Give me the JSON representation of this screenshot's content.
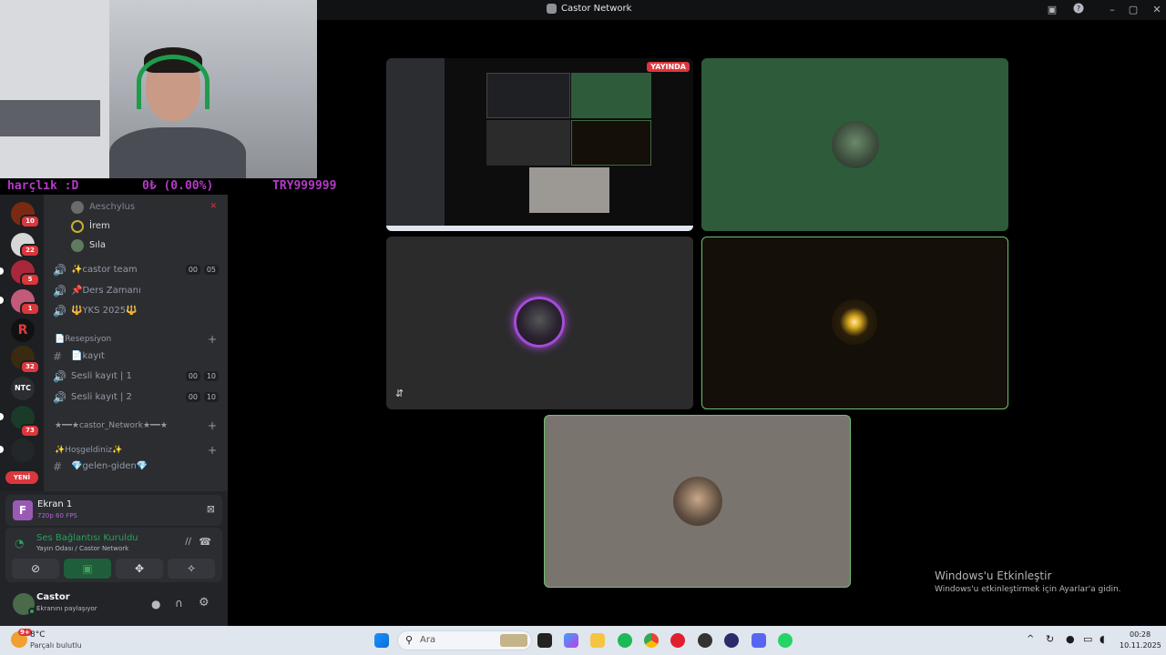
{
  "window": {
    "title": "Castor Network"
  },
  "ticker": {
    "left": "harçlık :D",
    "mid": "0₺ (0.00%)",
    "right": "TRY999999"
  },
  "servers": [
    {
      "badge": "10"
    },
    {
      "badge": "22"
    },
    {
      "badge": "5"
    },
    {
      "badge": "1"
    },
    {
      "badge": ""
    },
    {
      "badge": "32"
    },
    {
      "badge": ""
    },
    {
      "badge": "73"
    },
    {
      "badge": ""
    }
  ],
  "new_label": "YENİ",
  "channels": {
    "members": [
      "Aeschylus",
      "İrem",
      "Sıla"
    ],
    "voice": [
      {
        "label": "✨castor team",
        "count_a": "00",
        "count_b": "05"
      },
      {
        "label": "📌Ders Zamanı"
      },
      {
        "label": "🔱YKS 2025🔱"
      }
    ],
    "category_1": "📄Resepsiyon",
    "text_1": "📄kayıt",
    "rec_1": {
      "label": "Sesli kayıt | 1",
      "count_a": "00",
      "count_b": "10"
    },
    "rec_2": {
      "label": "Sesli kayıt | 2",
      "count_a": "00",
      "count_b": "10"
    },
    "category_2": "★━━★castor_Network★━━★",
    "category_3": "✨Hoşgeldiniz✨",
    "text_2": "💎gelen-giden💎"
  },
  "stream": {
    "title": "Ekran 1",
    "quality": "720p 60 FPS",
    "avatar_letter": "F"
  },
  "voice": {
    "status": "Ses Bağlantısı Kuruldu",
    "location": "Yayın Odası / Castor Network"
  },
  "user": {
    "name": "Castor",
    "status": "Ekranını paylaşıyor"
  },
  "live_badge": "YAYINDA",
  "watermark": {
    "title": "Windows'u Etkinleştir",
    "subtitle": "Windows'u etkinleştirmek için Ayarlar'a gidin."
  },
  "taskbar": {
    "weather_temp": "8°C",
    "weather_desc": "Parçalı bulutlu",
    "weather_badge": "9+",
    "search_placeholder": "Ara",
    "time": "00:28",
    "date": "10.11.2025"
  },
  "colors": {
    "accent_green": "#23a55a",
    "danger": "#da373c",
    "tile_green": "#2e5c3b",
    "tile_dark": "#2b2b2b",
    "tile_black": "#140f08",
    "tile_grey": "#7a746f"
  }
}
